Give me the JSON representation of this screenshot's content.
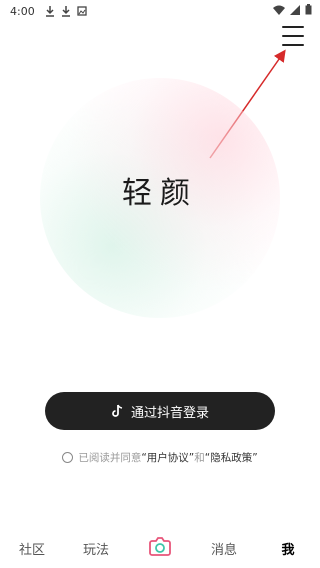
{
  "status_bar": {
    "time": "4:00",
    "left_icons": [
      "download-icon",
      "download-icon",
      "image-icon"
    ],
    "right_icons": [
      "wifi-icon",
      "signal-icon",
      "battery-icon"
    ]
  },
  "header": {
    "menu_icon": "menu-icon"
  },
  "hero": {
    "app_name": "轻颜"
  },
  "login": {
    "button_label": "通过抖音登录",
    "icon": "tiktok-icon"
  },
  "agreement": {
    "prefix": "已阅读并同意",
    "user_agreement": "“用户协议”",
    "and": "和",
    "privacy_policy": "“隐私政策”"
  },
  "bottom_nav": {
    "items": [
      {
        "label": "社区"
      },
      {
        "label": "玩法"
      },
      {
        "label": "",
        "icon": "camera-icon"
      },
      {
        "label": "消息"
      },
      {
        "label": "我",
        "active": true
      }
    ]
  },
  "colors": {
    "button_bg": "#222222",
    "annotation_arrow": "#d62a2a",
    "camera_accent": "#e8557a"
  }
}
